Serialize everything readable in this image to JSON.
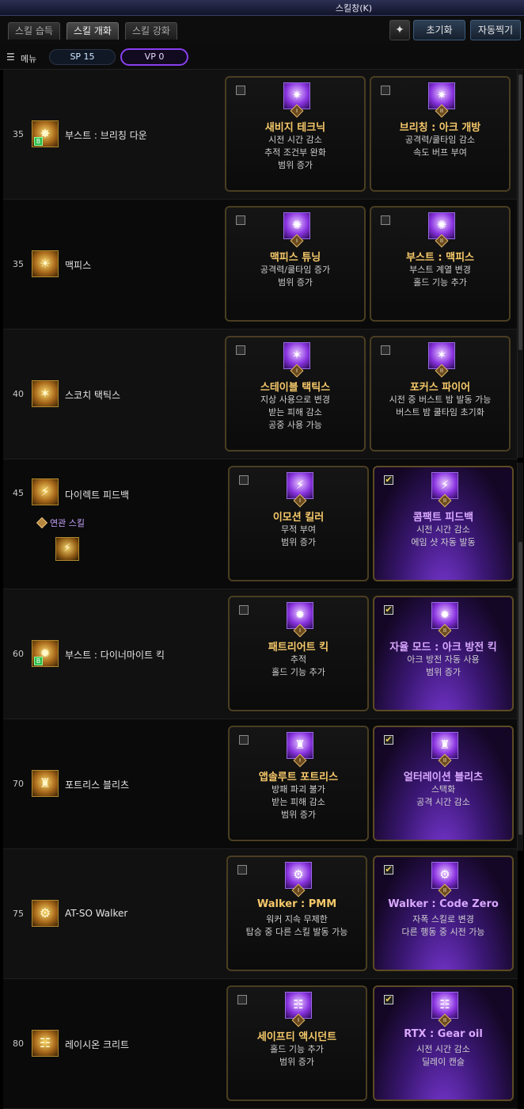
{
  "window": {
    "title": "스킬창(K)"
  },
  "tabs": [
    {
      "label": "스킬 습득",
      "active": false
    },
    {
      "label": "스킬 개화",
      "active": true
    },
    {
      "label": "스킬 강화",
      "active": false
    }
  ],
  "toolbar": {
    "reset_label": "초기화",
    "auto_label": "자동찍기"
  },
  "menu": {
    "label": "메뉴",
    "sp": "SP 15",
    "vp": "VP 0"
  },
  "skills": [
    {
      "level": "35",
      "name": "부스트 : 브리칭 다운",
      "badge": "B",
      "options": [
        {
          "rank": "I",
          "title": "새비지 테크닉",
          "desc": [
            "시전 시간 감소",
            "추적 조건부 완화",
            "범위 증가"
          ],
          "checked": false
        },
        {
          "rank": "II",
          "title": "브리칭 : 아크 개방",
          "desc": [
            "공격력/쿨타임 감소",
            "속도 버프 부여"
          ],
          "checked": false
        }
      ]
    },
    {
      "level": "35",
      "name": "맥피스",
      "badge": "",
      "options": [
        {
          "rank": "I",
          "title": "맥피스 튜닝",
          "desc": [
            "공격력/쿨타임 증가",
            "범위 증가"
          ],
          "checked": false
        },
        {
          "rank": "II",
          "title": "부스트 : 맥피스",
          "desc": [
            "부스트 계열 변경",
            "홀드 기능 추가"
          ],
          "checked": false
        }
      ]
    },
    {
      "level": "40",
      "name": "스코치 택틱스",
      "badge": "",
      "options": [
        {
          "rank": "I",
          "title": "스테이블 택틱스",
          "desc": [
            "지상 사용으로 변경",
            "받는 피해 감소",
            "공중 사용 가능"
          ],
          "checked": false
        },
        {
          "rank": "II",
          "title": "포커스 파이어",
          "desc": [
            "시전 중 버스트 밤 발동 가능",
            "버스트 밤 쿨타임 초기화"
          ],
          "checked": false
        }
      ]
    },
    {
      "level": "45",
      "name": "다이렉트 피드백",
      "badge": "",
      "related_label": "연관 스킬",
      "options": [
        {
          "rank": "I",
          "title": "이모션 킬러",
          "desc": [
            "무적 부여",
            "범위 증가"
          ],
          "checked": false
        },
        {
          "rank": "II",
          "title": "콤팩트 피드백",
          "desc": [
            "시전 시간 감소",
            "에임 샷 자동 발동"
          ],
          "checked": true
        }
      ]
    },
    {
      "level": "60",
      "name": "부스트 : 다이너마이트 킥",
      "badge": "B",
      "options": [
        {
          "rank": "I",
          "title": "패트리어트 킥",
          "desc": [
            "추적",
            "홀드 기능 추가"
          ],
          "checked": false
        },
        {
          "rank": "II",
          "title": "자율 모드 : 아크 방전 킥",
          "desc": [
            "아크 방전 자동 사용",
            "범위 증가"
          ],
          "checked": true
        }
      ]
    },
    {
      "level": "70",
      "name": "포트리스 블리츠",
      "badge": "",
      "options": [
        {
          "rank": "I",
          "title": "앱솔루트 포트리스",
          "desc": [
            "방패 파괴 불가",
            "받는 피해 감소",
            "범위 증가"
          ],
          "checked": false
        },
        {
          "rank": "II",
          "title": "얼터레이션 블리츠",
          "desc": [
            "스택화",
            "공격 시간 감소"
          ],
          "checked": true
        }
      ]
    },
    {
      "level": "75",
      "name": "AT-SO Walker",
      "badge": "",
      "options": [
        {
          "rank": "I",
          "title": "Walker : PMM",
          "desc": [
            "워커 지속 무제한",
            "탑승 중 다른 스킬 발동 가능"
          ],
          "checked": false
        },
        {
          "rank": "II",
          "title": "Walker : Code Zero",
          "desc": [
            "자폭 스킬로 변경",
            "다른 행동 중 시전 가능"
          ],
          "checked": true
        }
      ]
    },
    {
      "level": "80",
      "name": "레이시온 크리트",
      "badge": "",
      "options": [
        {
          "rank": "I",
          "title": "세이프티 액시던트",
          "desc": [
            "홀드 기능 추가",
            "범위 증가"
          ],
          "checked": false
        },
        {
          "rank": "II",
          "title": "RTX : Gear oil",
          "desc": [
            "시전 시간 감소",
            "딜레이 캔슬"
          ],
          "checked": true
        }
      ]
    }
  ],
  "colors": {
    "accent_purple": "#8a3ff0",
    "title_gold": "#f6c96a",
    "title_purple": "#d9a8ff",
    "badge_green": "#2dbb48"
  }
}
